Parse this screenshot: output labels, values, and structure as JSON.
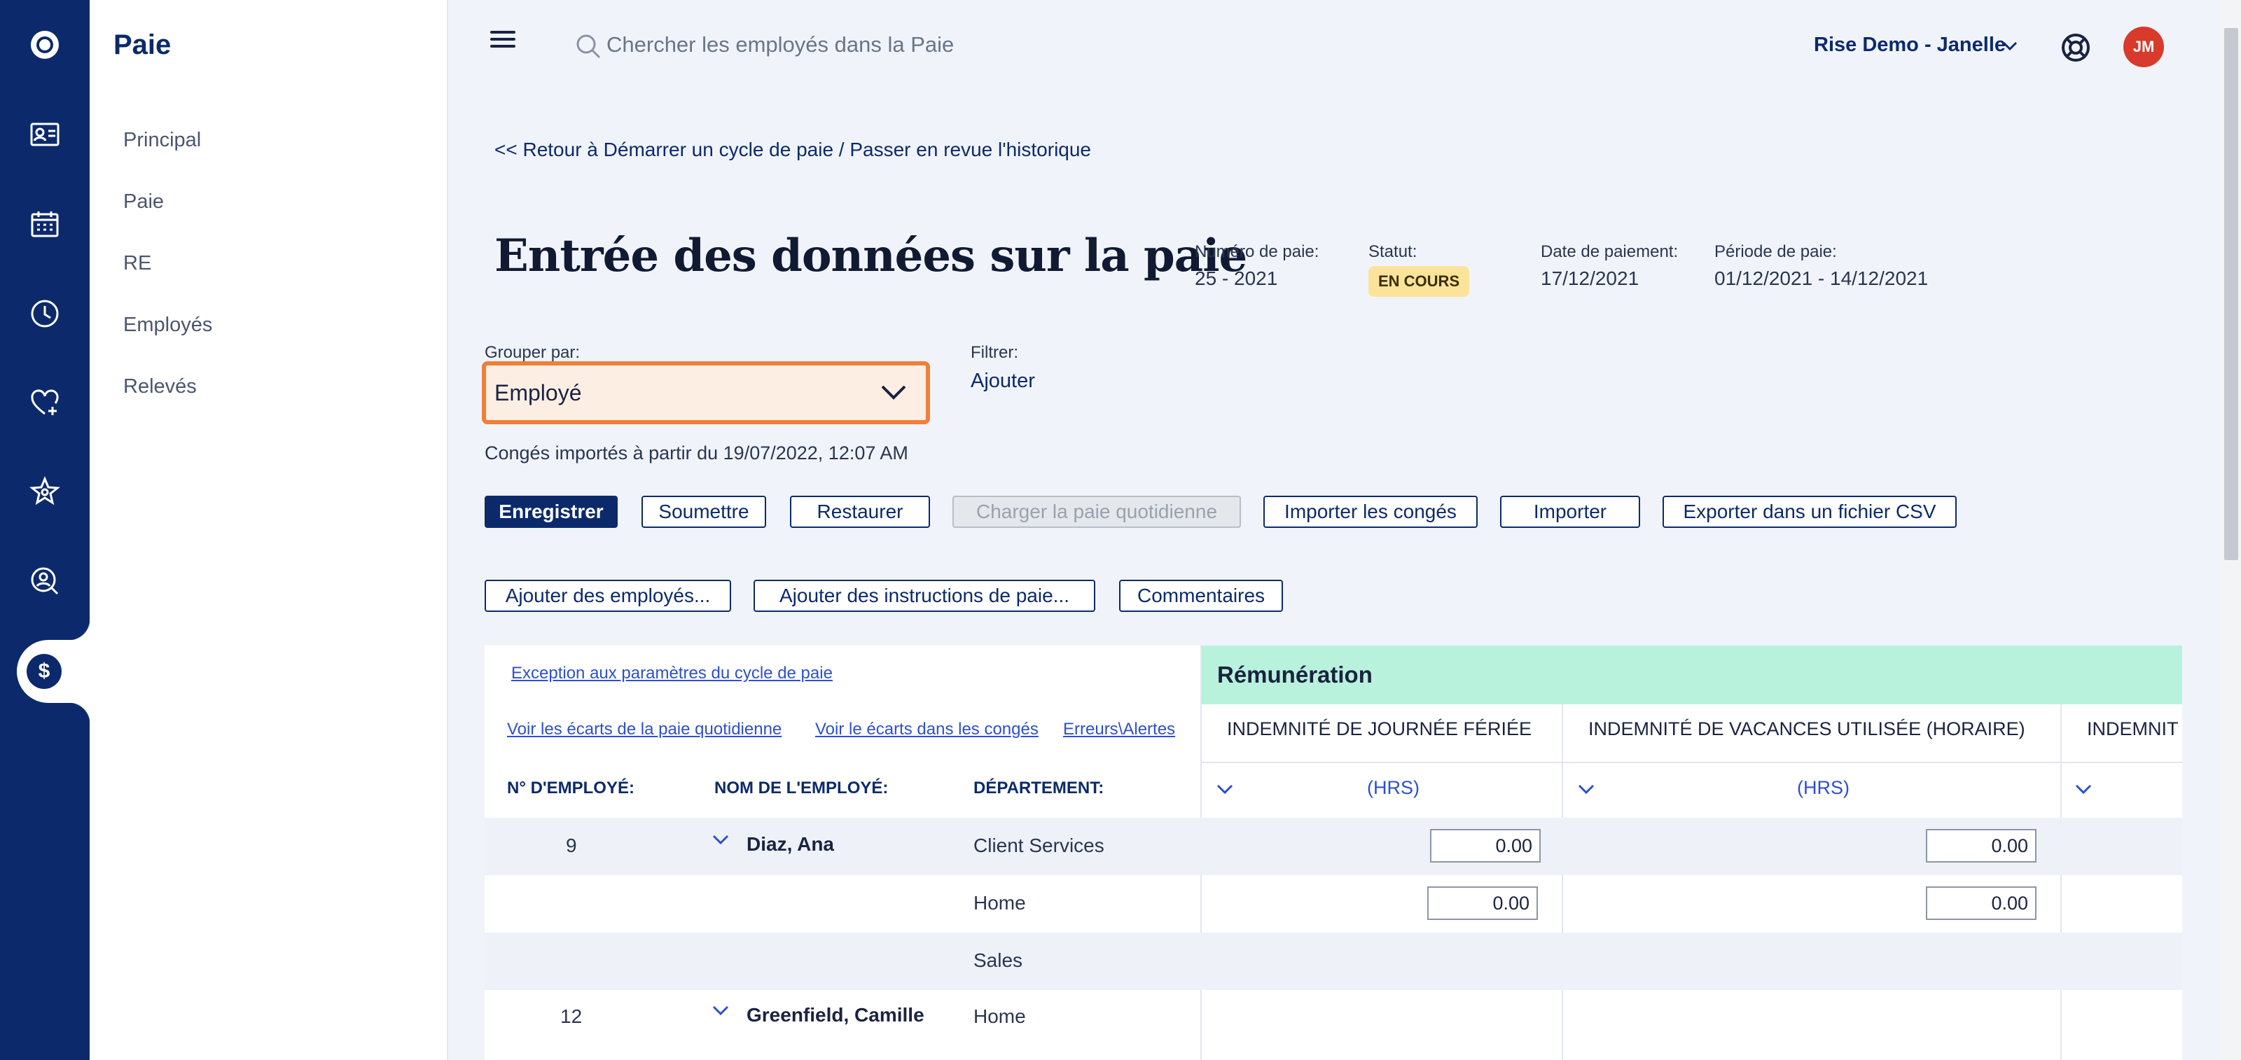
{
  "rail": {
    "icons": [
      "logo-icon",
      "id-card-icon",
      "calendar-icon",
      "clock-icon",
      "heart-plus-icon",
      "star-icon",
      "person-search-icon",
      "dollar-icon"
    ]
  },
  "subnav": {
    "title": "Paie",
    "items": [
      "Principal",
      "Paie",
      "RE",
      "Employés",
      "Relevés"
    ]
  },
  "header": {
    "search_placeholder": "Chercher les employés dans la Paie",
    "company": "Rise Demo - Janelle",
    "avatar_initials": "JM"
  },
  "content": {
    "back_link": "<< Retour à Démarrer un cycle de paie / Passer en revue l'historique",
    "title": "Entrée des données sur la paie",
    "meta": {
      "pay_number_label": "Numéro de paie:",
      "pay_number": "25 - 2021",
      "status_label": "Statut:",
      "status": "EN COURS",
      "pay_date_label": "Date de paiement:",
      "pay_date": "17/12/2021",
      "period_label": "Période de paie:",
      "period": "01/12/2021 - 14/12/2021"
    },
    "group_by_label": "Grouper par:",
    "group_by_value": "Employé",
    "filter_label": "Filtrer:",
    "filter_add": "Ajouter",
    "conges_note": "Congés importés à partir du 19/07/2022, 12:07 AM",
    "buttons_row1": [
      "Enregistrer",
      "Soumettre",
      "Restaurer",
      "Charger la paie quotidienne",
      "Importer les congés",
      "Importer",
      "Exporter dans un fichier CSV"
    ],
    "buttons_row2": [
      "Ajouter des employés...",
      "Ajouter des instructions de paie...",
      "Commentaires"
    ]
  },
  "table": {
    "exception_link": "Exception aux paramètres du cycle de paie",
    "links": [
      "Voir les écarts de la paie quotidienne",
      "Voir le écarts dans les congés",
      "Erreurs\\Alertes"
    ],
    "section": "Rémunération",
    "columns": [
      "INDEMNITÉ DE JOURNÉE FÉRIÉE",
      "INDEMNITÉ DE VACANCES UTILISÉE (HORAIRE)",
      "INDEMNIT"
    ],
    "unit": "(HRS)",
    "headers": [
      "N° D'EMPLOYÉ:",
      "NOM DE L'EMPLOYÉ:",
      "DÉPARTEMENT:"
    ],
    "rows": [
      {
        "num": "9",
        "name": "Diaz, Ana",
        "dept": "Client Services",
        "v1": "0.00",
        "v2": "0.00"
      },
      {
        "num": "",
        "name": "",
        "dept": "Home",
        "v1": "0.00",
        "v2": "0.00"
      },
      {
        "num": "",
        "name": "",
        "dept": "Sales",
        "v1": "",
        "v2": ""
      },
      {
        "num": "12",
        "name": "Greenfield, Camille",
        "dept": "Home",
        "v1": "",
        "v2": ""
      }
    ]
  },
  "colors": {
    "navy": "#0c2a6b",
    "highlight_border": "#ef7f3a",
    "remuneration_band": "#b9f2dc",
    "status_badge": "#fbe39a",
    "avatar": "#d83a2b"
  }
}
